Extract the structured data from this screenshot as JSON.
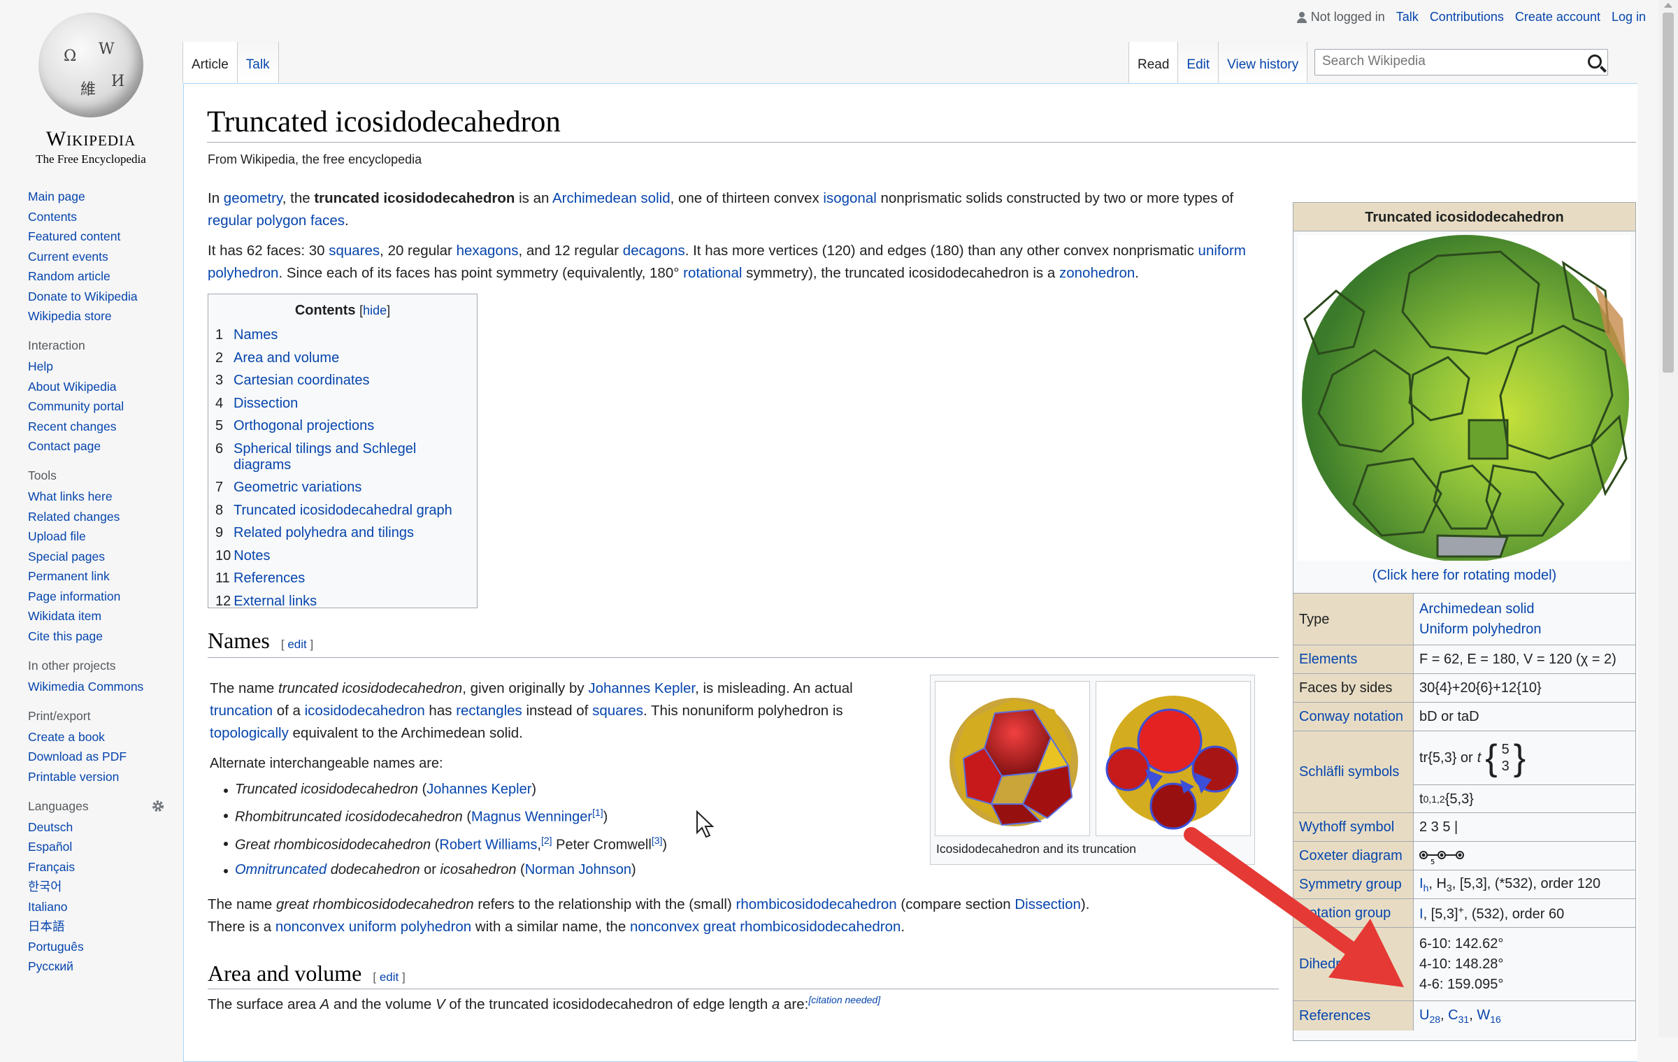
{
  "logo": {
    "wordmark": "Wikipedia",
    "tagline": "The Free Encyclopedia",
    "glyphs": [
      "Ω",
      "W",
      "維",
      "И"
    ]
  },
  "personal": {
    "not_logged": "Not logged in",
    "talk": "Talk",
    "contributions": "Contributions",
    "create": "Create account",
    "login": "Log in"
  },
  "tabs": {
    "article": "Article",
    "talk": "Talk",
    "read": "Read",
    "edit": "Edit",
    "history": "View history"
  },
  "search": {
    "placeholder": "Search Wikipedia"
  },
  "sidebar": {
    "navigation": [
      "Main page",
      "Contents",
      "Featured content",
      "Current events",
      "Random article",
      "Donate to Wikipedia",
      "Wikipedia store"
    ],
    "interaction_title": "Interaction",
    "interaction": [
      "Help",
      "About Wikipedia",
      "Community portal",
      "Recent changes",
      "Contact page"
    ],
    "tools_title": "Tools",
    "tools": [
      "What links here",
      "Related changes",
      "Upload file",
      "Special pages",
      "Permanent link",
      "Page information",
      "Wikidata item",
      "Cite this page"
    ],
    "projects_title": "In other projects",
    "projects": [
      "Wikimedia Commons"
    ],
    "print_title": "Print/export",
    "print": [
      "Create a book",
      "Download as PDF",
      "Printable version"
    ],
    "languages_title": "Languages",
    "languages": [
      "Deutsch",
      "Español",
      "Français",
      "한국어",
      "Italiano",
      "日本語",
      "Português",
      "Русский"
    ]
  },
  "article": {
    "title": "Truncated icosidodecahedron",
    "tagline": "From Wikipedia, the free encyclopedia",
    "p1": {
      "t1": "In ",
      "l1": "geometry",
      "t2": ", the ",
      "bold": "truncated icosidodecahedron",
      "t3": " is an ",
      "l2": "Archimedean solid",
      "t4": ", one of thirteen convex ",
      "l3": "isogonal",
      "t5": " nonprismatic solids constructed by two or more types of ",
      "l4": "regular polygon faces",
      "t6": "."
    },
    "p2": {
      "t1": "It has 62 faces: 30 ",
      "l1": "squares",
      "t2": ", 20 regular ",
      "l2": "hexagons",
      "t3": ", and 12 regular ",
      "l3": "decagons",
      "t4": ". It has more vertices (120) and edges (180) than any other convex nonprismatic ",
      "l4": "uniform polyhedron",
      "t5": ". Since each of its faces has point symmetry (equivalently, 180° ",
      "l5": "rotational",
      "t6": " symmetry), the truncated icosidodecahedron is a ",
      "l6": "zonohedron",
      "t7": "."
    },
    "toc": {
      "title": "Contents",
      "hide": "hide",
      "entries": [
        {
          "num": "1",
          "label": "Names"
        },
        {
          "num": "2",
          "label": "Area and volume"
        },
        {
          "num": "3",
          "label": "Cartesian coordinates"
        },
        {
          "num": "4",
          "label": "Dissection"
        },
        {
          "num": "5",
          "label": "Orthogonal projections"
        },
        {
          "num": "6",
          "label": "Spherical tilings and Schlegel diagrams"
        },
        {
          "num": "7",
          "label": "Geometric variations"
        },
        {
          "num": "8",
          "label": "Truncated icosidodecahedral graph"
        },
        {
          "num": "9",
          "label": "Related polyhedra and tilings"
        },
        {
          "num": "10",
          "label": "Notes"
        },
        {
          "num": "11",
          "label": "References"
        },
        {
          "num": "12",
          "label": "External links"
        }
      ]
    },
    "names": {
      "heading": "Names",
      "edit": "edit",
      "p1": {
        "t1": "The name ",
        "i1": "truncated icosidodecahedron",
        "t2": ", given originally by ",
        "l1": "Johannes Kepler",
        "t3": ", is misleading. An actual ",
        "l2": "truncation",
        "t4": " of a ",
        "l3": "icosidodecahedron",
        "t5": " has ",
        "l4": "rectangles",
        "t6": " instead of ",
        "l5": "squares",
        "t7": ". This nonuniform polyhedron is ",
        "l6": "topologically",
        "t8": " equivalent to the Archimedean solid."
      },
      "alt_intro": "Alternate interchangeable names are:",
      "list": {
        "a1": "Truncated icosidodecahedron",
        "a1l": "Johannes Kepler",
        "b1": "Rhombitruncated icosidodecahedron",
        "b1l": "Magnus Wenninger",
        "b1s": "[1]",
        "c1": "Great rhombicosidodecahedron",
        "c1l": "Robert Williams",
        "c1s": "[2]",
        "c1t": " Peter Cromwell",
        "c1s2": "[3]",
        "d1l": "Omnitruncated",
        "d1t": " dodecahedron",
        "d1o": " or ",
        "d1i": "icosahedron",
        "d1l2": "Norman Johnson"
      },
      "p2": {
        "t1": "The name ",
        "i1": "great rhombicosidodecahedron",
        "t2": " refers to the relationship with the (small) ",
        "l1": "rhombicosidodecahedron",
        "t3": " (compare section ",
        "l2": "Dissection",
        "t4": ").",
        "t5": "There is a ",
        "l3": "nonconvex uniform polyhedron",
        "t6": " with a similar name, the ",
        "l4": "nonconvex great rhombicosidodecahedron",
        "t7": "."
      },
      "figure_caption": "Icosidodecahedron and its truncation"
    },
    "area": {
      "heading": "Area and volume",
      "edit": "edit",
      "p1": {
        "t1": "The surface area ",
        "a": "A",
        "t2": " and the volume ",
        "v": "V",
        "t3": " of the truncated icosidodecahedron of edge length ",
        "e": "a",
        "t4": " are:",
        "cite": "[citation needed]"
      }
    }
  },
  "infobox": {
    "title": "Truncated icosidodecahedron",
    "rotate": "(Click here for rotating model)",
    "type_label": "Type",
    "type_v1": "Archimedean solid",
    "type_v2": "Uniform polyhedron",
    "elements_label": "Elements",
    "elements_val": "F = 62, E = 180, V = 120 (χ = 2)",
    "faces_label": "Faces by sides",
    "faces_val": "30{4}+20{6}+12{10}",
    "conway_label": "Conway notation",
    "conway_val": "bD or taD",
    "schlafli_label": "Schläfli symbols",
    "schlafli_v1": "tr{5,3} or",
    "schlafli_t": "t",
    "schlafli_top": "5",
    "schlafli_bot": "3",
    "schlafli_v2": "t",
    "schlafli_v2sub": "0,1,2",
    "schlafli_v2b": "{5,3}",
    "wythoff_label": "Wythoff symbol",
    "wythoff_val": "2 3 5 |",
    "coxeter_label": "Coxeter diagram",
    "coxeter_5": "5",
    "symmetry_label": "Symmetry group",
    "sym_l1": "I",
    "sym_l1sub": "h",
    "sym_rest": ", H",
    "sym_sub2": "3",
    "sym_rest2": ", [5,3], (*532), order 120",
    "rotation_label": "Rotation group",
    "rot_l": "I",
    "rot_rest": ", [5,3]",
    "rot_sup": "+",
    "rot_rest2": ", (532), order 60",
    "dihedral_label": "Dihedral",
    "dih1": "6-10: 142.62°",
    "dih2": "4-10: 148.28°",
    "dih3": "4-6: 159.095°",
    "references_label": "References",
    "ref_u": "U",
    "ref_usub": "28",
    "ref_c": "C",
    "ref_csub": "31",
    "ref_w": "W",
    "ref_wsub": "16"
  },
  "colors": {
    "link": "#0645ad",
    "infobox_header": "#e7dcc3",
    "annotation_arrow": "#e53935"
  }
}
